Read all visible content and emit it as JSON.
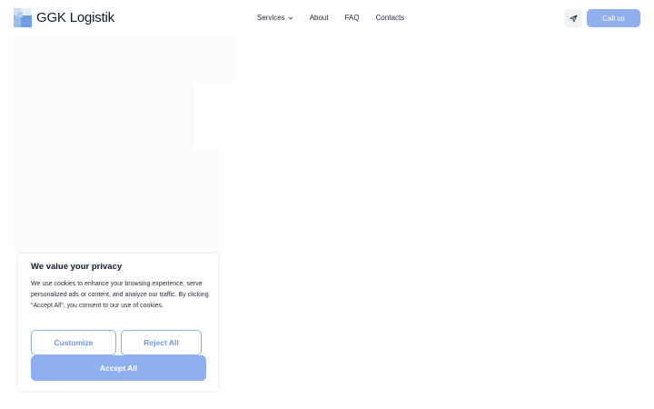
{
  "brand": {
    "name": "GGK Logistik"
  },
  "nav": {
    "items": [
      {
        "label": "Services",
        "icon": "chevron-down-icon"
      },
      {
        "label": "About"
      },
      {
        "label": "FAQ"
      },
      {
        "label": "Contacts"
      }
    ]
  },
  "header_actions": {
    "telegram_icon": "paper-plane-icon",
    "call_label": "Call us"
  },
  "cookie_banner": {
    "title": "We value your privacy",
    "text": "We use cookies to enhance your browsing experience, serve personalized ads or content, and analyze our traffic. By clicking \"Accept All\", you consent to our use of cookies.",
    "customize_label": "Customize",
    "reject_label": "Reject All",
    "accept_label": "Accept All"
  },
  "colors": {
    "accent": "#8fb0ee",
    "accent_text": "#6f97e3",
    "text": "#1f2937"
  }
}
